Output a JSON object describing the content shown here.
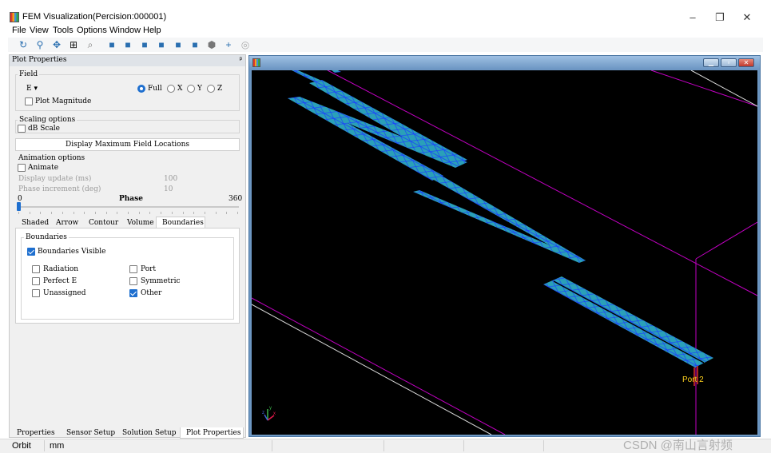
{
  "window": {
    "title": "FEM Visualization(Percision:000001)",
    "controls": {
      "minimize": "–",
      "restore": "❐",
      "close": "✕"
    }
  },
  "menu": [
    "File",
    "View",
    "Tools",
    "Options",
    "Window",
    "Help"
  ],
  "toolbar_icons": [
    "rotate-icon",
    "zoom-pan-icon",
    "move-icon",
    "fit-view-icon",
    "zoom-window-icon",
    "view-iso-icon",
    "view-front-icon",
    "view-back-icon",
    "view-top-icon",
    "view-bottom-icon",
    "view-left-icon",
    "view-right-icon",
    "crosshair-icon",
    "light-icon"
  ],
  "panel": {
    "title": "Plot Properties",
    "pin": "ᵖ",
    "field": {
      "group_label": "Field",
      "selected": "E",
      "plot_magnitude_label": "Plot Magnitude",
      "plot_magnitude_checked": false,
      "components": [
        {
          "label": "Full",
          "selected": true
        },
        {
          "label": "X",
          "selected": false
        },
        {
          "label": "Y",
          "selected": false
        },
        {
          "label": "Z",
          "selected": false
        }
      ]
    },
    "scaling": {
      "group_label": "Scaling options",
      "db_scale_label": "dB Scale",
      "db_scale_checked": false
    },
    "display_max_button": "Display Maximum Field Locations",
    "animation": {
      "group_label": "Animation options",
      "animate_label": "Animate",
      "animate_checked": false,
      "display_update_label": "Display update (ms)",
      "display_update_value": "100",
      "phase_increment_label": "Phase increment (deg)",
      "phase_increment_value": "10",
      "phase_min": "0",
      "phase_label": "Phase",
      "phase_max": "360",
      "phase_value": 0
    },
    "sub_tabs": [
      "Shaded",
      "Arrow",
      "Contour",
      "Volume",
      "Boundaries"
    ],
    "active_sub_tab": "Boundaries",
    "boundaries": {
      "group_label": "Boundaries",
      "visible_label": "Boundaries Visible",
      "visible_checked": true,
      "items": [
        {
          "label": "Radiation",
          "checked": false
        },
        {
          "label": "Port",
          "checked": false
        },
        {
          "label": "Perfect E",
          "checked": false
        },
        {
          "label": "Symmetric",
          "checked": false
        },
        {
          "label": "Unassigned",
          "checked": false
        },
        {
          "label": "Other",
          "checked": true
        }
      ]
    }
  },
  "bottom_tabs": [
    "Properties",
    "Sensor Setup",
    "Solution Setup",
    "Plot Properties"
  ],
  "active_bottom_tab": "Plot Properties",
  "viewport": {
    "port_label": "Port 2",
    "axis_labels": {
      "x": "x",
      "y": "y",
      "z": "z"
    },
    "colors": {
      "mesh_fill": "#2aa0b8",
      "mesh_edge": "#1b3cff",
      "outline": "#c000c0",
      "wire": "#d9d9d9",
      "port": "#ffd21e"
    }
  },
  "status": {
    "mode": "Orbit",
    "units": "mm"
  },
  "watermark": "CSDN @南山言射频"
}
